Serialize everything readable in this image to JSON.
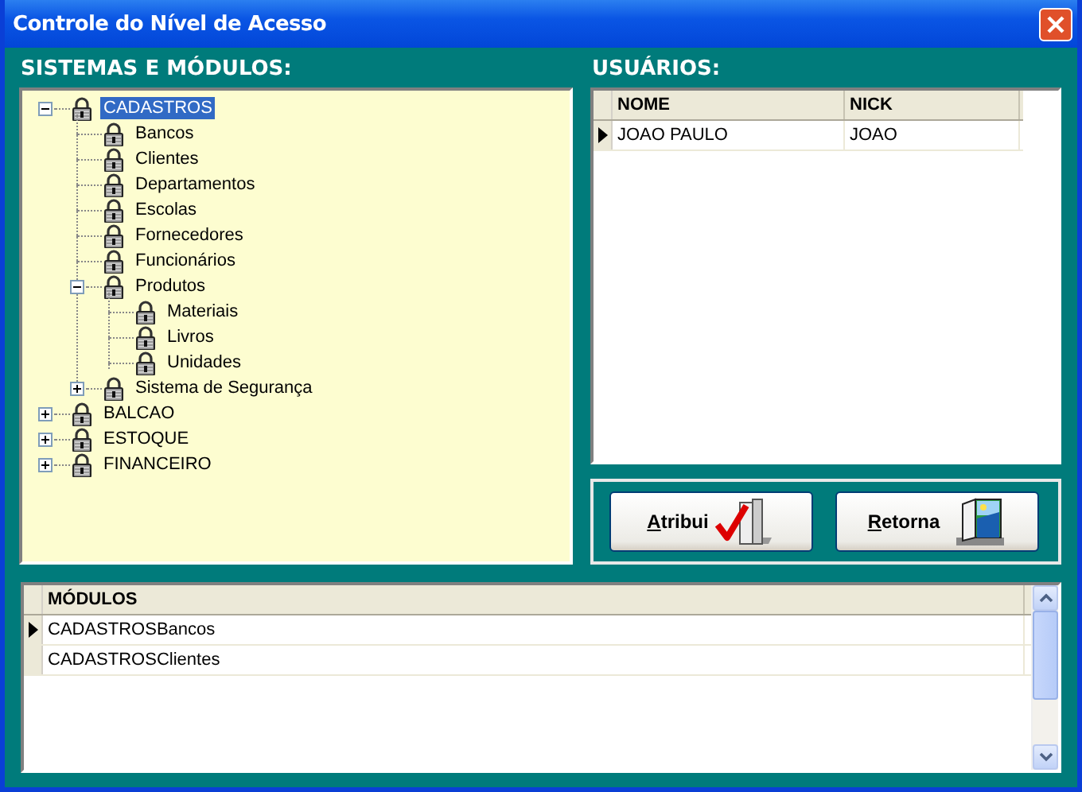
{
  "window": {
    "title": "Controle do Nível de Acesso"
  },
  "systems": {
    "label": "SISTEMAS E MÓDULOS:",
    "tree": [
      {
        "label": "CADASTROS",
        "selected": true,
        "expanded": true,
        "children": [
          {
            "label": "Bancos",
            "selected": false
          },
          {
            "label": "Clientes",
            "selected": false
          },
          {
            "label": "Departamentos",
            "selected": false
          },
          {
            "label": "Escolas",
            "selected": false
          },
          {
            "label": "Fornecedores",
            "selected": false
          },
          {
            "label": "Funcionários",
            "selected": false
          },
          {
            "label": "Produtos",
            "selected": false,
            "expanded": true,
            "children": [
              {
                "label": "Materiais",
                "selected": false
              },
              {
                "label": "Livros",
                "selected": false
              },
              {
                "label": "Unidades",
                "selected": false
              }
            ]
          },
          {
            "label": "Sistema de Segurança",
            "selected": false,
            "expanded": false
          }
        ]
      },
      {
        "label": "BALCAO",
        "selected": false,
        "expanded": false
      },
      {
        "label": "ESTOQUE",
        "selected": false,
        "expanded": false
      },
      {
        "label": "FINANCEIRO",
        "selected": false,
        "expanded": false
      }
    ]
  },
  "users": {
    "label": "USUÁRIOS:",
    "columns": [
      "NOME",
      "NICK"
    ],
    "rows": [
      {
        "cells": [
          "JOAO PAULO",
          "JOAO"
        ],
        "selected": true
      }
    ]
  },
  "buttons": [
    {
      "label": "Atribui",
      "kind": "assign"
    },
    {
      "label": "Retorna",
      "kind": "return"
    }
  ],
  "modules": {
    "columns": [
      "MÓDULOS"
    ],
    "rows": [
      {
        "cells": [
          "CADASTROSBancos"
        ],
        "selected": true
      },
      {
        "cells": [
          "CADASTROSClientes"
        ],
        "selected": false
      }
    ]
  }
}
